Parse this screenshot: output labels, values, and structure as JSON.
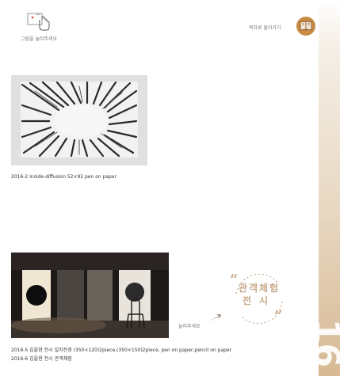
{
  "header": {
    "tap_caption": "그림을 눌러주세요",
    "toc_link": "목차로 돌아가기"
  },
  "works": [
    {
      "caption": "2016-2 Inside-diffusion  52×92 pen on paper"
    },
    {
      "caption": "2016-5 김을현 전시 설치전경 (350×120)2piece,(350×150)2piece,  pen on paper,pencil on paper",
      "sub_caption": "2016-6 김을현 전시 관객체험"
    }
  ],
  "badge": {
    "line1": "관객체험",
    "line2": "전시",
    "hint": "눌러주세요"
  },
  "side": {
    "year_fragment": "16"
  },
  "colors": {
    "accent": "#c78b45",
    "badge": "#c9a98b",
    "tap_red": "#d9534f"
  },
  "icons": {
    "tap": "hand-tap-icon",
    "toc": "book-icon",
    "badge_arrow": "arrow-icon"
  }
}
